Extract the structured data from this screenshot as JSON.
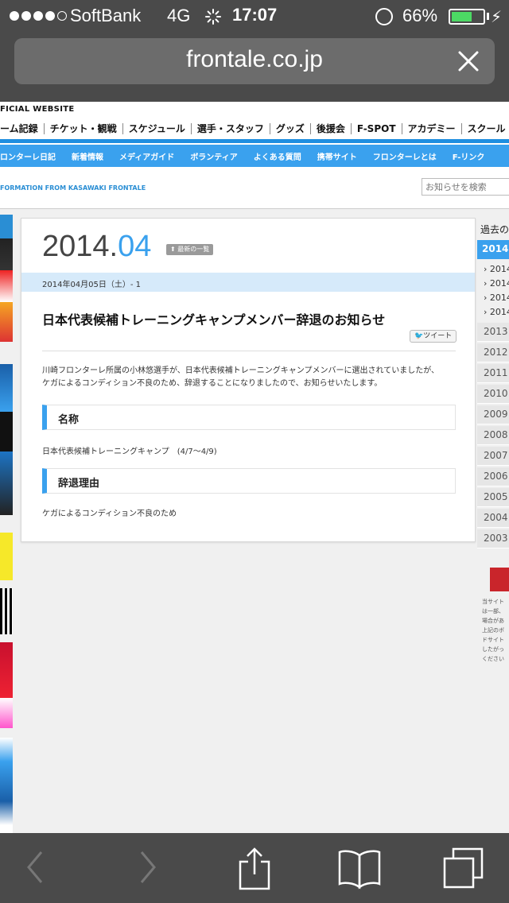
{
  "status_bar": {
    "carrier": "SoftBank",
    "network": "4G",
    "time": "17:07",
    "battery_pct": "66%",
    "battery_level": 0.66
  },
  "address_bar": {
    "url": "frontale.co.jp"
  },
  "site": {
    "title": "FICIAL WEBSITE",
    "global_nav": [
      "ーム記録",
      "チケット・観戦",
      "スケジュール",
      "選手・スタッフ",
      "グッズ",
      "後援会",
      "F-SPOT",
      "アカデミー",
      "スクール・普及"
    ],
    "sub_nav": [
      "ロンターレ日記",
      "新着情報",
      "メディアガイド",
      "ボランティア",
      "よくある質問",
      "携帯サイト",
      "フロンターレとは",
      "F-リンク"
    ],
    "info_from": "FORMATION FROM KASAWAKI FRONTALE",
    "search_placeholder": "お知らせを検索"
  },
  "article": {
    "year": "2014.",
    "month": "04",
    "list_button": "最新の一覧",
    "date": "2014年04月05日（土）- 1",
    "headline": "日本代表候補トレーニングキャンプメンバー辞退のお知らせ",
    "tweet_label": "ツイート",
    "body_line1": "川崎フロンターレ所属の小林悠選手が、日本代表候補トレーニングキャンプメンバーに選出されていましたが、",
    "body_line2": "ケガによるコンディション不良のため、辞退することになりましたので、お知らせいたします。",
    "section1_title": "名称",
    "section1_text": "日本代表候補トレーニングキャンプ　(4/7〜4/9)",
    "section2_title": "辞退理由",
    "section2_text": "ケガによるコンディション不良のため"
  },
  "archive": {
    "heading": "過去の",
    "active": "2014",
    "months": [
      "› 2014",
      "› 2014",
      "› 2014",
      "› 2014"
    ],
    "years": [
      "2013",
      "2012",
      "2011",
      "2010",
      "2009",
      "2008",
      "2007",
      "2006",
      "2005",
      "2004",
      "2003"
    ],
    "notes": [
      "当サイト",
      "は一部、",
      "場合があ",
      "上記のボ",
      "ドサイト",
      "したがっ",
      "ください"
    ]
  },
  "toolbar": {
    "back": "back-icon",
    "forward": "forward-icon",
    "share": "share-icon",
    "bookmarks": "bookmarks-icon",
    "tabs": "tabs-icon"
  },
  "colors": {
    "accent": "#3aa1ee",
    "battery": "#4cd964"
  }
}
